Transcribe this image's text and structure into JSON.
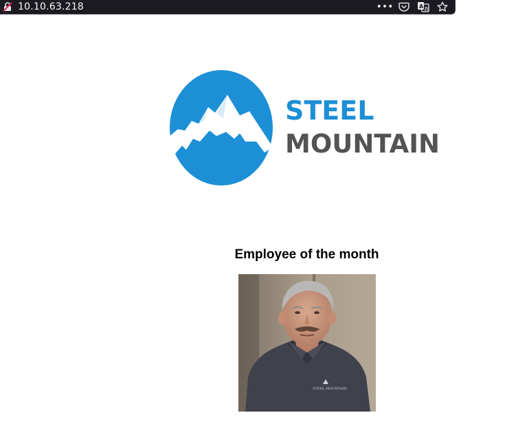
{
  "browser": {
    "url": "10.10.63.218",
    "icons": [
      "insecure-lock-icon",
      "more-icon",
      "pocket-icon",
      "translate-icon",
      "bookmark-star-icon"
    ]
  },
  "logo": {
    "line1": "STEEL",
    "line2": "MOUNTAIN",
    "brand_blue": "#1d8fd6",
    "brand_gray": "#535353"
  },
  "employee": {
    "heading": "Employee of the month",
    "shirt_logo": "STEEL MOUNTAIN"
  }
}
